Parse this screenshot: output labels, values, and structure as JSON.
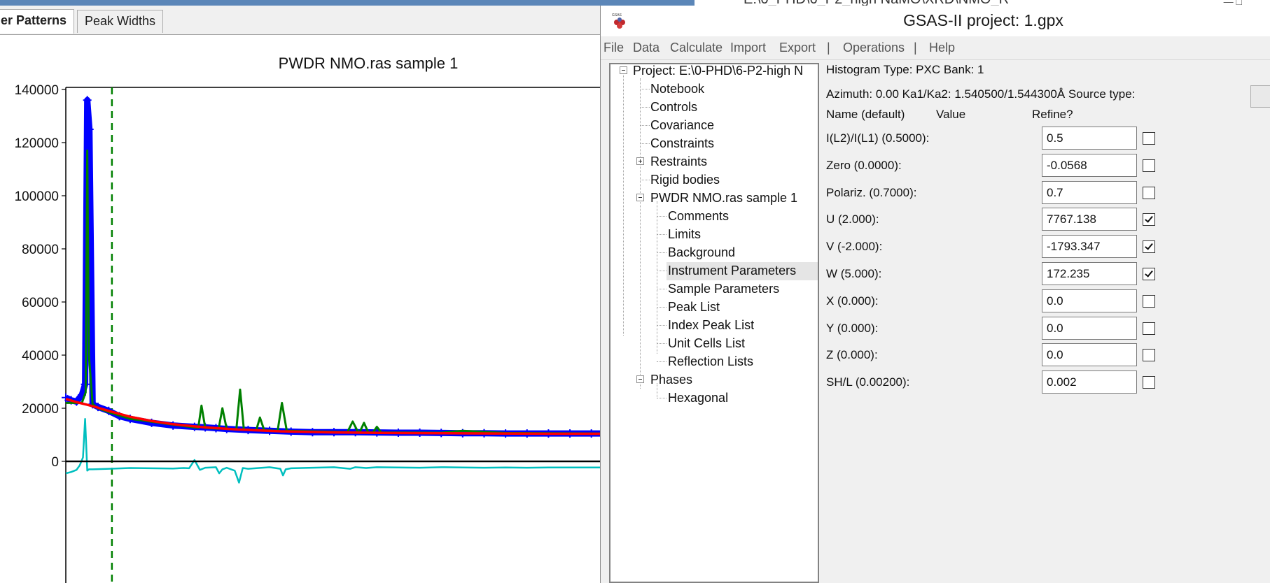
{
  "plot_window": {
    "tabs": [
      "er Patterns",
      "Peak Widths"
    ],
    "active_tab": 0
  },
  "chart_data": {
    "type": "line",
    "title": "PWDR NMO.ras sample 1",
    "y_ticks": [
      0,
      20000,
      40000,
      60000,
      80000,
      100000,
      120000,
      140000
    ],
    "y_tick_labels": [
      "0",
      "20000",
      "40000",
      "60000",
      "80000",
      "100000",
      "120000",
      "140000"
    ],
    "xlabel": "",
    "ylabel": "",
    "x_visible_range": [
      0,
      100
    ],
    "ylim": [
      -15000,
      152000
    ],
    "vertical_marker_x": 8.6,
    "grid": false,
    "series": [
      {
        "role": "observed",
        "marker": "+",
        "color": "#0000ff",
        "x": [
          0,
          1,
          2,
          3,
          3.6,
          4,
          4.4,
          5,
          6,
          8,
          10,
          12,
          16,
          20,
          24,
          26,
          28,
          30,
          34,
          38,
          42,
          46,
          50,
          54,
          58,
          62,
          66,
          70,
          74,
          78,
          82,
          86,
          90,
          94,
          98,
          100
        ],
        "values": [
          24000,
          23000,
          22500,
          25000,
          29000,
          136000,
          125000,
          21500,
          20500,
          19000,
          17000,
          16000,
          14500,
          13500,
          13000,
          12800,
          12500,
          12200,
          11800,
          11500,
          11200,
          11000,
          11000,
          11000,
          10900,
          10800,
          10800,
          10700,
          10600,
          10600,
          10500,
          10500,
          10500,
          10500,
          10500,
          10500
        ]
      },
      {
        "role": "calculated",
        "color": "#008000",
        "x": [
          0,
          3,
          3.7,
          4,
          4.3,
          5,
          6,
          8,
          12,
          20,
          24.7,
          25.3,
          26,
          28.5,
          29.2,
          30,
          31.8,
          32.5,
          33.2,
          35.5,
          36.2,
          37,
          39.5,
          40.3,
          41.2,
          52.5,
          53.5,
          54.5,
          54.8,
          55.6,
          56.4,
          57.3,
          58,
          58.8,
          70,
          74,
          82,
          90,
          100
        ],
        "values": [
          22000,
          22000,
          26000,
          117000,
          40000,
          21500,
          20000,
          18500,
          16000,
          13800,
          12600,
          21000,
          12600,
          12300,
          20000,
          12200,
          12000,
          27000,
          12000,
          11700,
          16500,
          11700,
          11500,
          22000,
          11500,
          11000,
          15000,
          11000,
          11000,
          14500,
          10900,
          10900,
          13000,
          10900,
          10800,
          11500,
          10700,
          10600,
          10500
        ]
      },
      {
        "role": "background",
        "color": "#ff0000",
        "x": [
          0,
          2,
          4,
          6,
          8,
          12,
          16,
          20,
          26,
          32,
          40,
          50,
          60,
          70,
          80,
          90,
          100
        ],
        "values": [
          23500,
          22300,
          21300,
          20200,
          19000,
          16800,
          15200,
          14000,
          12800,
          12000,
          11300,
          10900,
          10700,
          10600,
          10500,
          10400,
          10400
        ]
      },
      {
        "role": "difference",
        "color": "#00bfbf",
        "x": [
          0,
          1,
          2,
          2.6,
          3.2,
          3.6,
          4,
          4.3,
          5,
          8,
          12,
          20,
          22,
          23,
          24,
          25,
          26,
          28,
          28.6,
          29.2,
          30,
          31.5,
          32.3,
          33,
          34,
          36,
          38,
          40,
          40.5,
          41,
          42,
          46,
          50,
          53,
          54,
          56,
          58,
          62,
          66,
          70,
          74,
          78,
          82,
          86,
          90,
          94,
          100
        ],
        "values": [
          -4500,
          -4000,
          -3200,
          -1500,
          1500,
          16000,
          -3500,
          -3000,
          -3000,
          -2800,
          -2500,
          -2700,
          -2500,
          -2600,
          500,
          -3200,
          -2400,
          -2200,
          -4500,
          -3000,
          -2400,
          -3500,
          -8000,
          -2500,
          -2800,
          -2500,
          -2200,
          -2800,
          -5300,
          -3000,
          -2600,
          -2400,
          -2200,
          -2800,
          -2200,
          -2500,
          -2200,
          -2300,
          -2400,
          -2200,
          -2300,
          -2400,
          -2300,
          -2400,
          -2300,
          -2300,
          -2300
        ]
      },
      {
        "role": "zero-line",
        "color": "#000000",
        "x": [
          0,
          100
        ],
        "values": [
          0,
          0
        ]
      }
    ]
  },
  "background_window": {
    "title_fragment": "E:\\0_PHD\\6_P2_high NaMO\\XRD\\NMO_R"
  },
  "gsas_window": {
    "title": "GSAS-II project: 1.gpx",
    "logo_icon": "gsas-logo",
    "menu": [
      "File",
      "Data",
      "Calculate",
      "Import",
      "Export",
      "|",
      "Operations",
      "|",
      "Help"
    ],
    "tree": {
      "root": "Project: E:\\0-PHD\\6-P2-high N",
      "items": [
        "Notebook",
        "Controls",
        "Covariance",
        "Constraints",
        "Restraints",
        "Rigid bodies"
      ],
      "histogram": "PWDR NMO.ras sample 1",
      "histogram_children": [
        "Comments",
        "Limits",
        "Background",
        "Instrument Parameters",
        "Sample Parameters",
        "Peak List",
        "Index Peak List",
        "Unit Cells List",
        "Reflection Lists"
      ],
      "selected": "Instrument Parameters",
      "phases": "Phases",
      "phase_children": [
        "Hexagonal"
      ]
    },
    "params": {
      "histogram_type_line": "Histogram Type: PXC  Bank: 1",
      "azimuth_line": "Azimuth: 0.00   Ka1/Ka2: 1.540500/1.544300Å  Source type:",
      "source_type_value": "",
      "header_name": "Name (default)",
      "header_value": "Value",
      "header_refine": "Refine?",
      "rows": [
        {
          "label": "I(L2)/I(L1) (0.5000):",
          "value": "0.5",
          "refine": false
        },
        {
          "label": "Zero (0.0000):",
          "value": "-0.0568",
          "refine": false
        },
        {
          "label": "Polariz. (0.7000):",
          "value": "0.7",
          "refine": false
        },
        {
          "label": "U (2.000):",
          "value": "7767.138",
          "refine": true
        },
        {
          "label": "V (-2.000):",
          "value": "-1793.347",
          "refine": true
        },
        {
          "label": "W (5.000):",
          "value": "172.235",
          "refine": true
        },
        {
          "label": "X (0.000):",
          "value": "0.0",
          "refine": false
        },
        {
          "label": "Y (0.000):",
          "value": "0.0",
          "refine": false
        },
        {
          "label": "Z (0.000):",
          "value": "0.0",
          "refine": false
        },
        {
          "label": "SH/L (0.00200):",
          "value": "0.002",
          "refine": false
        }
      ]
    }
  }
}
